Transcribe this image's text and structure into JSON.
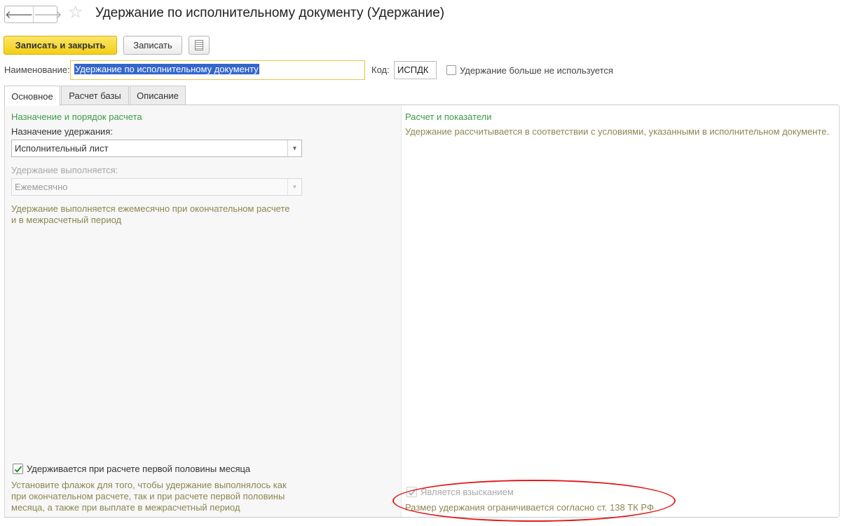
{
  "window": {
    "title": "Удержание по исполнительному документу (Удержание)",
    "back_glyph": "🡐",
    "forward_glyph": "🡒",
    "star_glyph": "☆"
  },
  "toolbar": {
    "save_close_label": "Записать и закрыть",
    "save_label": "Записать"
  },
  "form": {
    "name_label": "Наименование:",
    "name_value": "Удержание по исполнительному документу",
    "code_label": "Код:",
    "code_value": "ИСПДК",
    "unused_label": "Удержание больше не используется"
  },
  "tabs": [
    {
      "label": "Основное",
      "active": true
    },
    {
      "label": "Расчет базы",
      "active": false
    },
    {
      "label": "Описание",
      "active": false
    }
  ],
  "left": {
    "section_title": "Назначение и порядок расчета",
    "purpose_label": "Назначение удержания:",
    "purpose_value": "Исполнительный лист",
    "exec_label": "Удержание выполняется:",
    "exec_value": "Ежемесячно",
    "exec_note_line1": "Удержание выполняется ежемесячно при окончательном расчете",
    "exec_note_line2": "и в межрасчетный период",
    "first_half_label": "Удерживается при расчете первой половины месяца",
    "first_half_note_line1": "Установите флажок для того, чтобы удержание выполнялось как",
    "first_half_note_line2": "при окончательном расчете, так и при расчете первой половины",
    "first_half_note_line3": "месяца, а также при выплате в межрасчетный период"
  },
  "right": {
    "section_title": "Расчет и показатели",
    "note": "Удержание рассчитывается в соответствии с условиями, указанными в исполнительном документе.",
    "collection_label": "Является взысканием",
    "collection_note": "Размер удержания ограничивается согласно ст. 138 ТК РФ"
  },
  "colors": {
    "accent_button": "#f3cf16",
    "section_green": "#3d9b48",
    "note_olive": "#8d8650",
    "highlight_red": "#e01b1b",
    "selection_blue": "#3366cc"
  }
}
